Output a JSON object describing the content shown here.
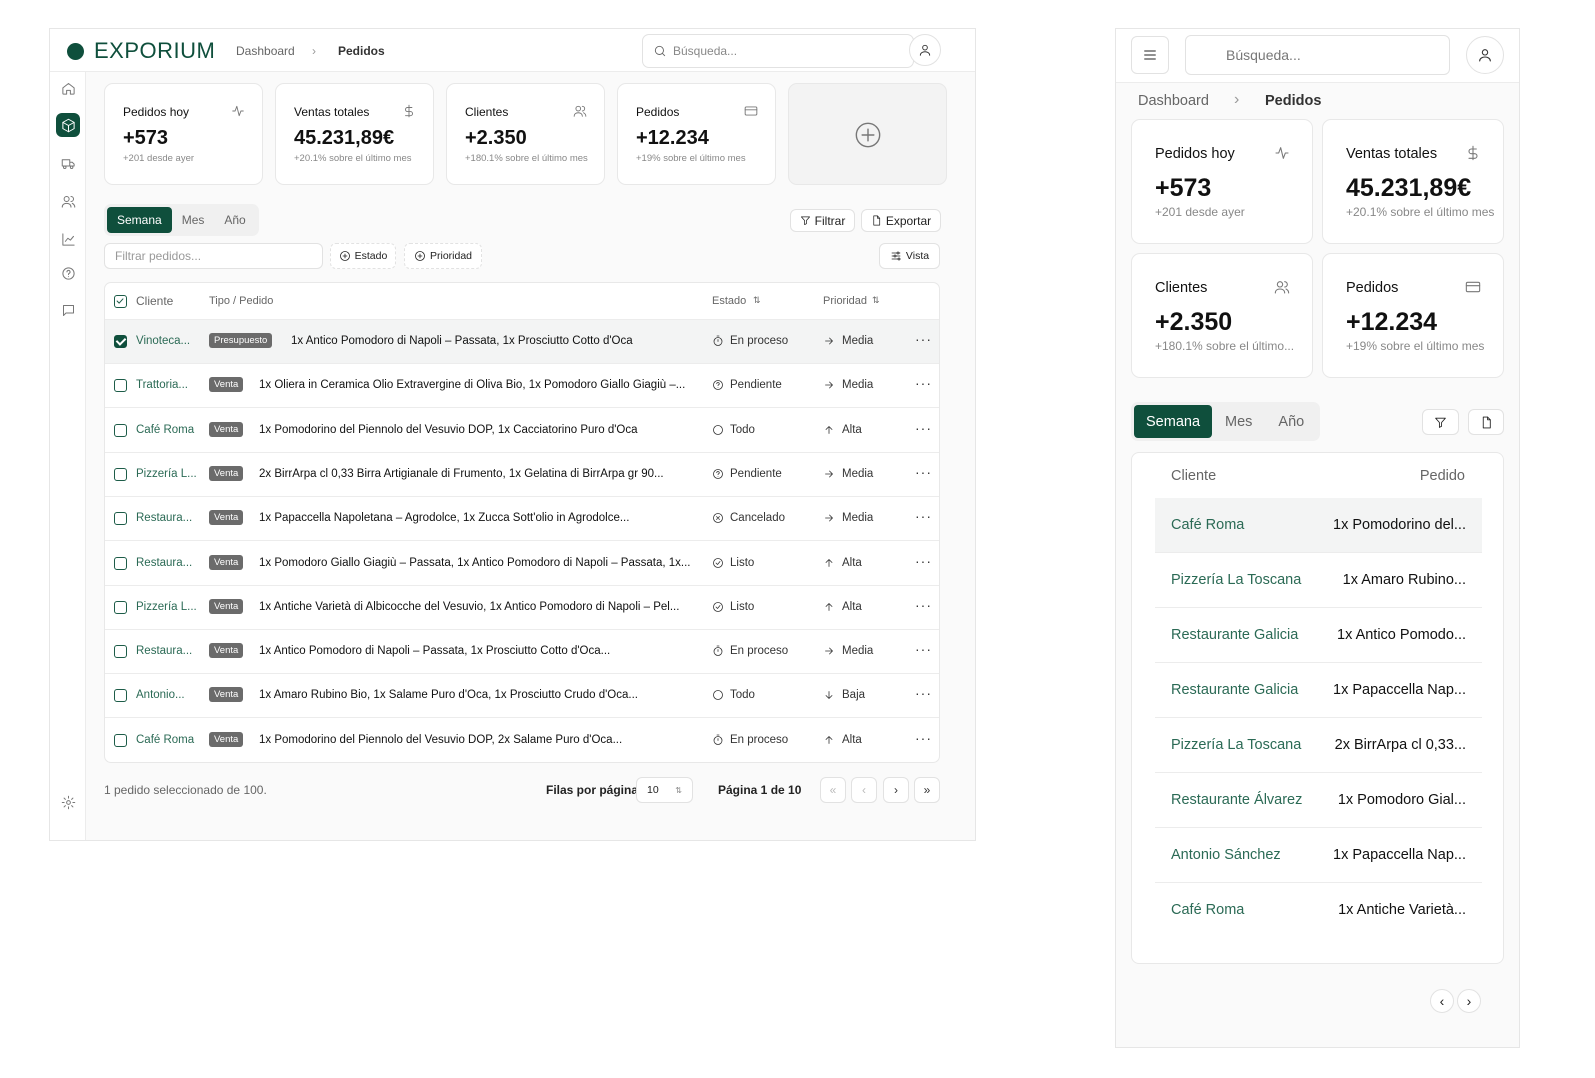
{
  "brand": {
    "name": "EXPORIUM",
    "color": "#0f4f3c"
  },
  "breadcrumb": {
    "home": "Dashboard",
    "current": "Pedidos"
  },
  "search": {
    "placeholder": "Búsqueda..."
  },
  "sidebar": {
    "items": [
      {
        "icon": "home-icon"
      },
      {
        "icon": "package-icon",
        "active": true
      },
      {
        "icon": "truck-icon"
      },
      {
        "icon": "users-icon"
      },
      {
        "icon": "chart-icon"
      },
      {
        "icon": "help-icon"
      },
      {
        "icon": "message-icon"
      },
      {
        "icon": "settings-icon"
      }
    ]
  },
  "stats": [
    {
      "label": "Pedidos hoy",
      "value": "+573",
      "sub": "+201 desde ayer",
      "icon": "activity-icon"
    },
    {
      "label": "Ventas totales",
      "value": "45.231,89€",
      "sub": "+20.1% sobre el último mes",
      "icon": "dollar-icon"
    },
    {
      "label": "Clientes",
      "value": "+2.350",
      "sub": "+180.1% sobre el último mes",
      "sub_mobile": "+180.1% sobre el último...",
      "icon": "users-icon"
    },
    {
      "label": "Pedidos",
      "value": "+12.234",
      "sub": "+19% sobre el último mes",
      "icon": "credit-card-icon"
    }
  ],
  "add_card": {
    "icon": "plus-circle-icon"
  },
  "period_tabs": [
    "Semana",
    "Mes",
    "Año"
  ],
  "toolbar": {
    "filter": "Filtrar",
    "export": "Exportar",
    "filter_placeholder": "Filtrar pedidos...",
    "estado": "Estado",
    "prioridad": "Prioridad",
    "vista": "Vista"
  },
  "table": {
    "headers": {
      "cliente": "Cliente",
      "tipo": "Tipo / Pedido",
      "estado": "Estado",
      "prioridad": "Prioridad"
    },
    "rows": [
      {
        "cliente": "Vinoteca...",
        "tipo": "Presupuesto",
        "pedido": "1x Antico Pomodoro di Napoli – Passata, 1x Prosciutto Cotto d'Oca",
        "estado": "En proceso",
        "estado_icon": "timer-icon",
        "prioridad": "Media",
        "prio_icon": "arrow-right-icon",
        "selected": true
      },
      {
        "cliente": "Trattoria...",
        "tipo": "Venta",
        "pedido": "1x Oliera in Ceramica Olio Extravergine di Oliva Bio, 1x Pomodoro Giallo Giagiù –...",
        "estado": "Pendiente",
        "estado_icon": "help-circle-icon",
        "prioridad": "Media",
        "prio_icon": "arrow-right-icon",
        "selected": false
      },
      {
        "cliente": "Café Roma",
        "tipo": "Venta",
        "pedido": "1x Pomodorino del Piennolo del Vesuvio DOP, 1x Cacciatorino Puro d'Oca",
        "estado": "Todo",
        "estado_icon": "circle-icon",
        "prioridad": "Alta",
        "prio_icon": "arrow-up-icon",
        "selected": false
      },
      {
        "cliente": "Pizzería L...",
        "tipo": "Venta",
        "pedido": "2x BirrArpa cl 0,33 Birra Artigianale di Frumento, 1x Gelatina di BirrArpa gr 90...",
        "estado": "Pendiente",
        "estado_icon": "help-circle-icon",
        "prioridad": "Media",
        "prio_icon": "arrow-right-icon",
        "selected": false
      },
      {
        "cliente": "Restaura...",
        "tipo": "Venta",
        "pedido": "1x Papaccella Napoletana – Agrodolce, 1x Zucca Sott'olio in Agrodolce...",
        "estado": "Cancelado",
        "estado_icon": "x-circle-icon",
        "prioridad": "Media",
        "prio_icon": "arrow-right-icon",
        "selected": false
      },
      {
        "cliente": "Restaura...",
        "tipo": "Venta",
        "pedido": "1x Pomodoro Giallo Giagiù – Passata, 1x Antico Pomodoro di Napoli – Passata, 1x...",
        "estado": "Listo",
        "estado_icon": "check-circle-icon",
        "prioridad": "Alta",
        "prio_icon": "arrow-up-icon",
        "selected": false
      },
      {
        "cliente": "Pizzería L...",
        "tipo": "Venta",
        "pedido": "1x Antiche Varietà di Albicocche del Vesuvio, 1x Antico Pomodoro di Napoli – Pel...",
        "estado": "Listo",
        "estado_icon": "check-circle-icon",
        "prioridad": "Alta",
        "prio_icon": "arrow-up-icon",
        "selected": false
      },
      {
        "cliente": "Restaura...",
        "tipo": "Venta",
        "pedido": "1x Antico Pomodoro di Napoli – Passata, 1x Prosciutto Cotto d'Oca...",
        "estado": "En proceso",
        "estado_icon": "timer-icon",
        "prioridad": "Media",
        "prio_icon": "arrow-right-icon",
        "selected": false
      },
      {
        "cliente": "Antonio...",
        "tipo": "Venta",
        "pedido": "1x Amaro Rubino Bio, 1x Salame Puro d'Oca, 1x Prosciutto Crudo d'Oca...",
        "estado": "Todo",
        "estado_icon": "circle-icon",
        "prioridad": "Baja",
        "prio_icon": "arrow-down-icon",
        "selected": false
      },
      {
        "cliente": "Café Roma",
        "tipo": "Venta",
        "pedido": "1x Pomodorino del Piennolo del Vesuvio DOP, 2x Salame Puro d'Oca...",
        "estado": "En proceso",
        "estado_icon": "timer-icon",
        "prioridad": "Alta",
        "prio_icon": "arrow-up-icon",
        "selected": false
      }
    ]
  },
  "footer": {
    "selection": "1 pedido seleccionado de 100.",
    "rows_label": "Filas por página",
    "rows_value": "10",
    "page_label": "Página 1 de 10"
  },
  "mobile": {
    "headers": {
      "cliente": "Cliente",
      "pedido": "Pedido"
    },
    "rows": [
      {
        "cliente": "Café Roma",
        "pedido": "1x Pomodorino del...",
        "selected": true
      },
      {
        "cliente": "Pizzería La Toscana",
        "pedido": "1x Amaro Rubino..."
      },
      {
        "cliente": "Restaurante Galicia",
        "pedido": "1x Antico Pomodo..."
      },
      {
        "cliente": "Restaurante Galicia",
        "pedido": "1x Papaccella Nap..."
      },
      {
        "cliente": "Pizzería La Toscana",
        "pedido": "2x BirrArpa cl 0,33..."
      },
      {
        "cliente": "Restaurante Álvarez",
        "pedido": "1x Pomodoro Gial..."
      },
      {
        "cliente": "Antonio Sánchez",
        "pedido": "1x Papaccella Nap..."
      },
      {
        "cliente": "Café Roma",
        "pedido": "1x Antiche Varietà..."
      }
    ]
  }
}
